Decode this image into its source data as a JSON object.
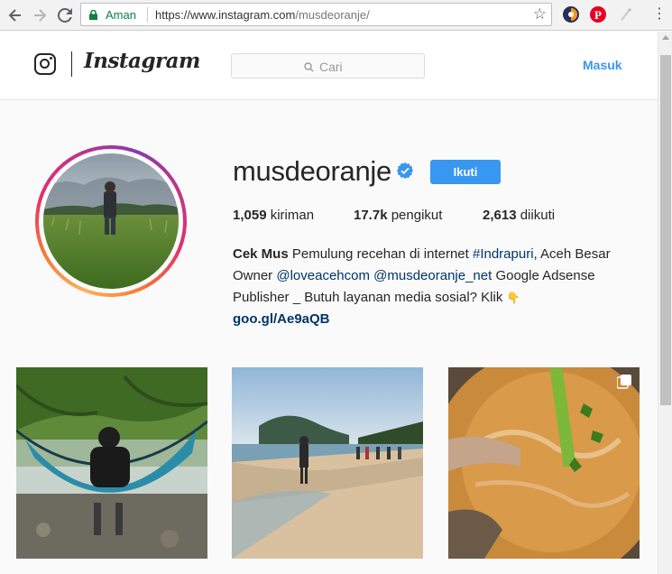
{
  "browser": {
    "secure_label": "Aman",
    "url_host": "https://www.instagram.com",
    "url_path": "/musdeoranje/",
    "icons": [
      "back-icon",
      "forward-icon",
      "reload-icon",
      "lock-icon",
      "bookmark-star-icon",
      "menu-icon"
    ]
  },
  "header": {
    "wordmark": "Instagram",
    "search_placeholder": "Cari",
    "login_label": "Masuk"
  },
  "profile": {
    "username": "musdeoranje",
    "verified": true,
    "follow_label": "Ikuti",
    "stats": {
      "posts_count": "1,059",
      "posts_label": "kiriman",
      "followers_count": "17.7k",
      "followers_label": "pengikut",
      "following_count": "2,613",
      "following_label": "diikuti"
    },
    "bio": {
      "name": "Cek Mus",
      "text_1": " Pemulung recehan di internet ",
      "hashtag": "#Indrapuri",
      "text_2": ", Aceh Besar Owner ",
      "mention_1": "@loveacehcom",
      "text_3": " ",
      "mention_2": "@musdeoranje_net",
      "text_4": " Google Adsense Publisher _ Butuh layanan media sosial? Klik ",
      "pointer_emoji": "👇",
      "link": "goo.gl/Ae9aQB"
    }
  },
  "posts": [
    {
      "subject": "hammock-in-forest",
      "multiple": false
    },
    {
      "subject": "beach-people",
      "multiple": false
    },
    {
      "subject": "cooking-curry",
      "multiple": true
    }
  ],
  "colors": {
    "accent": "#3897f0",
    "link": "#003569",
    "secure": "#0b8043"
  }
}
